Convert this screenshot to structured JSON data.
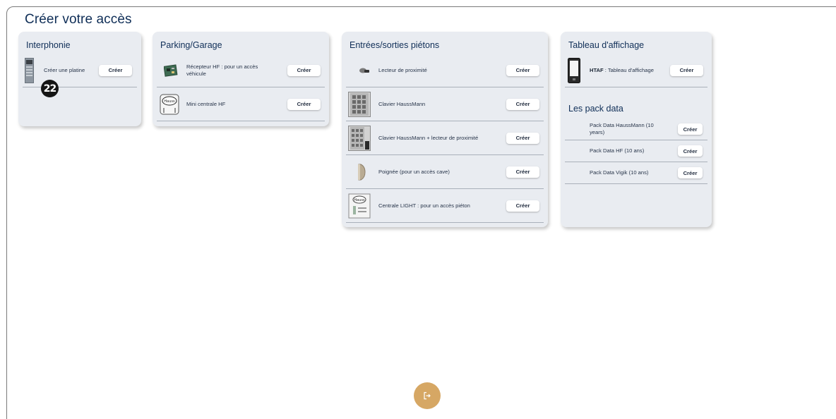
{
  "page": {
    "title": "Créer votre accès"
  },
  "badge": {
    "value": "22"
  },
  "cards": {
    "interphonie": {
      "title": "Interphonie",
      "items": [
        {
          "label": "Créer une platine",
          "button": "Créer",
          "icon": "intercom-panel-icon"
        }
      ]
    },
    "parking": {
      "title": "Parking/Garage",
      "items": [
        {
          "label": "Récepteur HF : pour un accès véhicule",
          "button": "Créer",
          "icon": "hf-receiver-icon"
        },
        {
          "label": "Mini centrale HF",
          "button": "Créer",
          "icon": "mini-central-icon"
        }
      ]
    },
    "pietons": {
      "title": "Entrées/sorties piétons",
      "items": [
        {
          "label": "Lecteur de proximité",
          "button": "Créer",
          "icon": "proximity-reader-icon"
        },
        {
          "label": "Clavier HaussMann",
          "button": "Créer",
          "icon": "keypad-icon"
        },
        {
          "label": "Clavier HaussMann + lecteur de proximité",
          "button": "Créer",
          "icon": "keypad-reader-icon"
        },
        {
          "label": "Poignée (pour un accès cave)",
          "button": "Créer",
          "icon": "handle-icon"
        },
        {
          "label": "Centrale LIGHT : pour un accès piéton",
          "button": "Créer",
          "icon": "central-light-icon"
        }
      ]
    },
    "affichage": {
      "title": "Tableau d'affichage",
      "items": [
        {
          "label_bold": "HTAF",
          "label_rest": " : Tableau d'affichage",
          "button": "Créer",
          "icon": "display-board-icon"
        }
      ],
      "subtitle": "Les pack data",
      "packs": [
        {
          "label": "Pack Data HaussMann (10 years)",
          "button": "Créer"
        },
        {
          "label": "Pack Data HF (10 ans)",
          "button": "Créer"
        },
        {
          "label": "Pack Data Vigik (10 ans)",
          "button": "Créer"
        }
      ]
    }
  },
  "colors": {
    "title": "#0f2e57",
    "card_bg": "#e9ecf1",
    "logout": "#d6a764"
  },
  "logout": {
    "icon": "logout-icon"
  }
}
